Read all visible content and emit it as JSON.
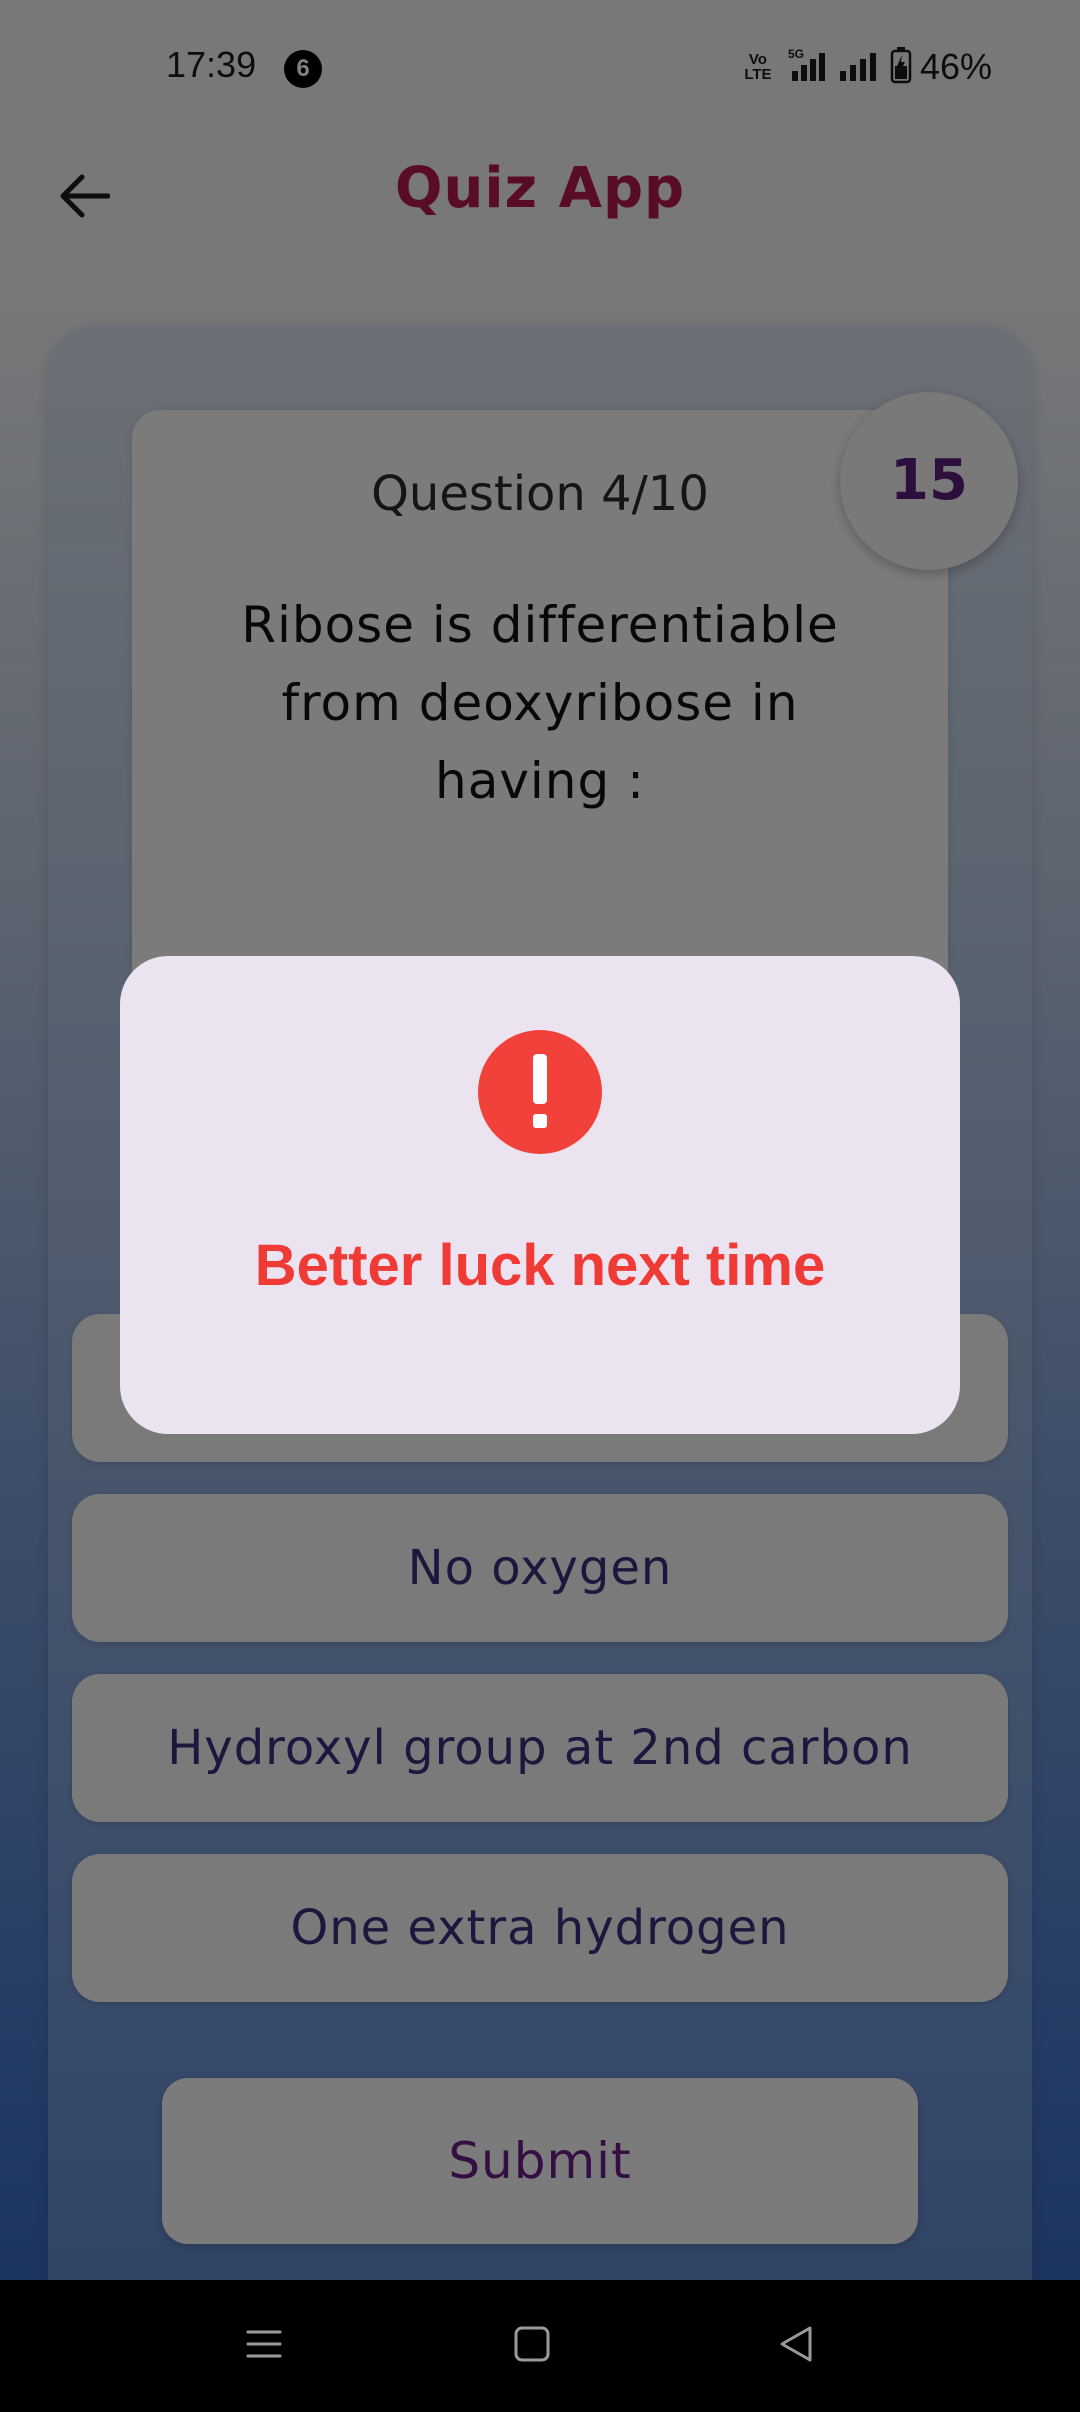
{
  "status_bar": {
    "time": "17:39",
    "notification_count": "6",
    "network": "5G",
    "volte": "Vo LTE",
    "battery": "46%"
  },
  "app_bar": {
    "title": "Quiz App",
    "back_icon": "arrow-left-icon"
  },
  "quiz": {
    "question_number": "Question 4/10",
    "question_text": "Ribose is differentiable from deoxyribose in having :",
    "timer": "15",
    "options": [
      "",
      "No oxygen",
      "Hydroxyl group at 2nd carbon",
      "One extra hydrogen"
    ],
    "submit_label": "Submit"
  },
  "dialog": {
    "icon": "exclamation-icon",
    "message": "Better luck next time",
    "accent_color": "#f2413b"
  },
  "colors": {
    "title": "#b2194b",
    "option_text": "#3a2f7a",
    "submit_text": "#6a1f86",
    "timer_text": "#5b1e7a"
  },
  "nav_bar": {
    "icons": [
      "menu-icon",
      "home-icon",
      "back-triangle-icon"
    ]
  }
}
